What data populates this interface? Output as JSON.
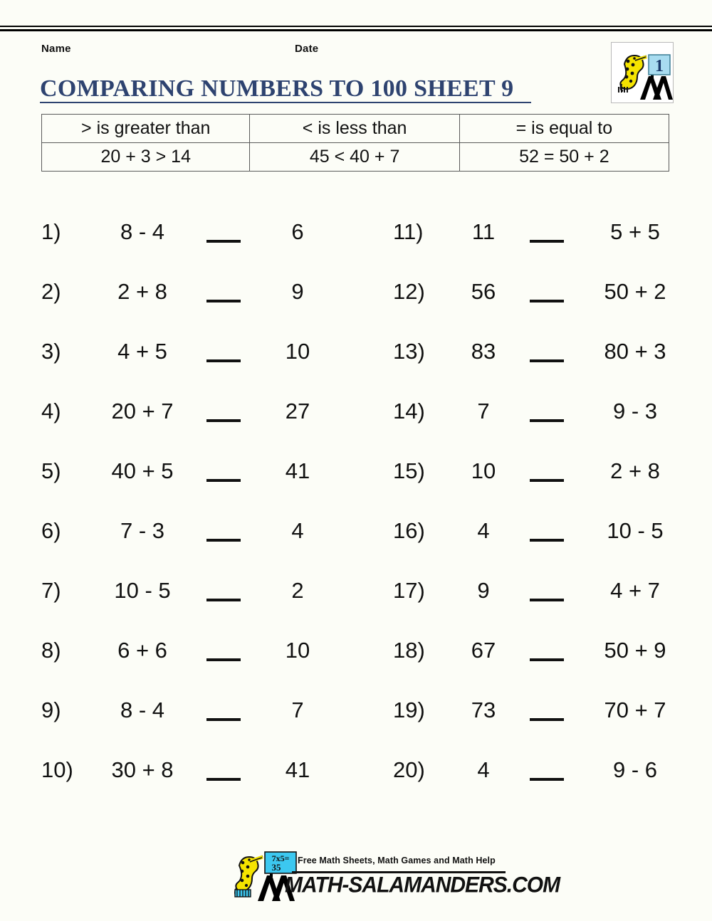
{
  "header": {
    "name_label": "Name",
    "date_label": "Date"
  },
  "title": "COMPARING NUMBERS TO 100 SHEET 9",
  "grade_logo": {
    "icon": "salamander-grade-icon",
    "grade": "1"
  },
  "reference_table": {
    "headers": [
      "> is greater than",
      "< is less than",
      "= is equal to"
    ],
    "examples": [
      "20 + 3 > 14",
      "45 < 40 + 7",
      "52 = 50 + 2"
    ]
  },
  "problems_left": [
    {
      "num": "1)",
      "lhs": "8 - 4",
      "blank": "__",
      "rhs": "6"
    },
    {
      "num": "2)",
      "lhs": "2 + 8",
      "blank": "__",
      "rhs": "9"
    },
    {
      "num": "3)",
      "lhs": "4 + 5",
      "blank": "__",
      "rhs": "10"
    },
    {
      "num": "4)",
      "lhs": "20 + 7",
      "blank": "__",
      "rhs": "27"
    },
    {
      "num": "5)",
      "lhs": "40 + 5",
      "blank": "__",
      "rhs": "41"
    },
    {
      "num": "6)",
      "lhs": "7 - 3",
      "blank": "__",
      "rhs": "4"
    },
    {
      "num": "7)",
      "lhs": "10 - 5",
      "blank": "__",
      "rhs": "2"
    },
    {
      "num": "8)",
      "lhs": "6 + 6",
      "blank": "__",
      "rhs": "10"
    },
    {
      "num": "9)",
      "lhs": "8 - 4",
      "blank": "__",
      "rhs": "7"
    },
    {
      "num": "10)",
      "lhs": "30 + 8",
      "blank": "__",
      "rhs": "41"
    }
  ],
  "problems_right": [
    {
      "num": "11)",
      "lhs": "11",
      "blank": "__",
      "rhs": "5 + 5"
    },
    {
      "num": "12)",
      "lhs": "56",
      "blank": "__",
      "rhs": "50 + 2"
    },
    {
      "num": "13)",
      "lhs": "83",
      "blank": "__",
      "rhs": "80 + 3"
    },
    {
      "num": "14)",
      "lhs": "7",
      "blank": "__",
      "rhs": "9 - 3"
    },
    {
      "num": "15)",
      "lhs": "10",
      "blank": "__",
      "rhs": "2 + 8"
    },
    {
      "num": "16)",
      "lhs": "4",
      "blank": "__",
      "rhs": "10 - 5"
    },
    {
      "num": "17)",
      "lhs": "9",
      "blank": "__",
      "rhs": "4 + 7"
    },
    {
      "num": "18)",
      "lhs": "67",
      "blank": "__",
      "rhs": "50 + 9"
    },
    {
      "num": "19)",
      "lhs": "73",
      "blank": "__",
      "rhs": "70 + 7"
    },
    {
      "num": "20)",
      "lhs": "4",
      "blank": "__",
      "rhs": "9 - 6"
    }
  ],
  "footer": {
    "tagline": "Free Math Sheets, Math Games and Math Help",
    "url": "MATH-SALAMANDERS.COM",
    "logo_icon": "salamander-logo-icon",
    "logo_board_text_line1": "7x5=",
    "logo_board_text_line2": "35"
  },
  "colors": {
    "title": "#2e4370",
    "text": "#111111",
    "page_bg": "#fcfdf7",
    "board_blue": "#a8dcf0",
    "salamander_yellow": "#f5e400"
  }
}
